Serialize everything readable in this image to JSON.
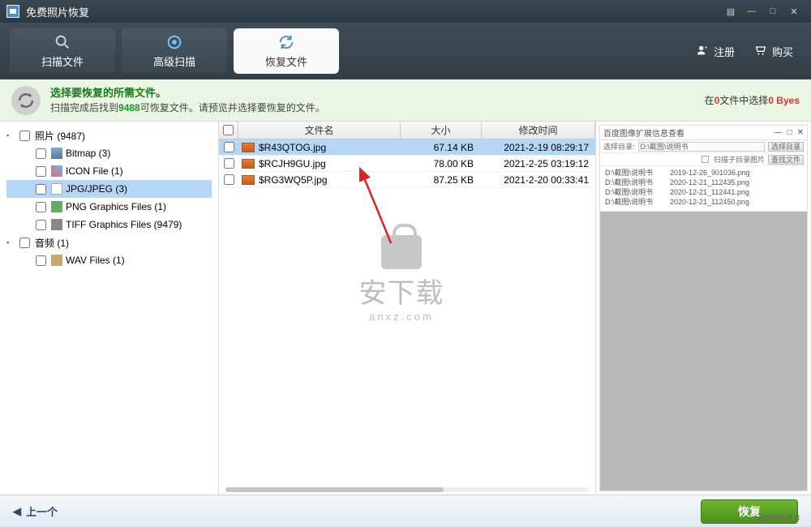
{
  "app": {
    "title": "免费照片恢复"
  },
  "toolbar": {
    "tabs": {
      "scan": "扫描文件",
      "advanced": "高级扫描",
      "recover": "恢复文件"
    },
    "register": "注册",
    "buy": "购买"
  },
  "info": {
    "line1": "选择要恢复的所需文件。",
    "line2a": "扫描完成后找到",
    "count": "9488",
    "line2b": "可恢复文件。请预览并选择要恢复的文件。",
    "right_a": "在",
    "right_zero1": "0",
    "right_b": "文件中选择",
    "right_zero2": "0 Byes"
  },
  "tree": {
    "photos": "照片 (9487)",
    "bitmap": "Bitmap (3)",
    "icon": "ICON File (1)",
    "jpeg": "JPG/JPEG (3)",
    "png": "PNG Graphics Files (1)",
    "tiff": "TIFF Graphics Files (9479)",
    "audio": "音频 (1)",
    "wav": "WAV Files (1)"
  },
  "file_headers": {
    "name": "文件名",
    "size": "大小",
    "date": "修改时间"
  },
  "files": [
    {
      "name": "$R43QTOG.jpg",
      "size": "67.14 KB",
      "date": "2021-2-19 08:29:17"
    },
    {
      "name": "$RCJH9GU.jpg",
      "size": "78.00 KB",
      "date": "2021-2-25 03:19:12"
    },
    {
      "name": "$RG3WQ5P.jpg",
      "size": "87.25 KB",
      "date": "2021-2-20 00:33:41"
    }
  ],
  "preview": {
    "title": "百度图像扩展信息查看",
    "label": "选择目录:",
    "path": "D:\\截图\\说明书",
    "btn_select": "选择目录",
    "chk_scan": "扫描子目录图片",
    "btn_read": "查找文件",
    "rows": [
      {
        "p": "D:\\截图\\说明书",
        "f": "2019-12-26_901036.png"
      },
      {
        "p": "D:\\截图\\说明书",
        "f": "2020-12-21_112435.png"
      },
      {
        "p": "D:\\截图\\说明书",
        "f": "2020-12-21_112441.png"
      },
      {
        "p": "D:\\截图\\说明书",
        "f": "2020-12-21_112450.png"
      }
    ]
  },
  "bottom": {
    "back": "上一个",
    "recover": "恢复"
  },
  "version": "Version 8.8",
  "watermark": {
    "main": "安下载",
    "sub": "anxz.com"
  }
}
